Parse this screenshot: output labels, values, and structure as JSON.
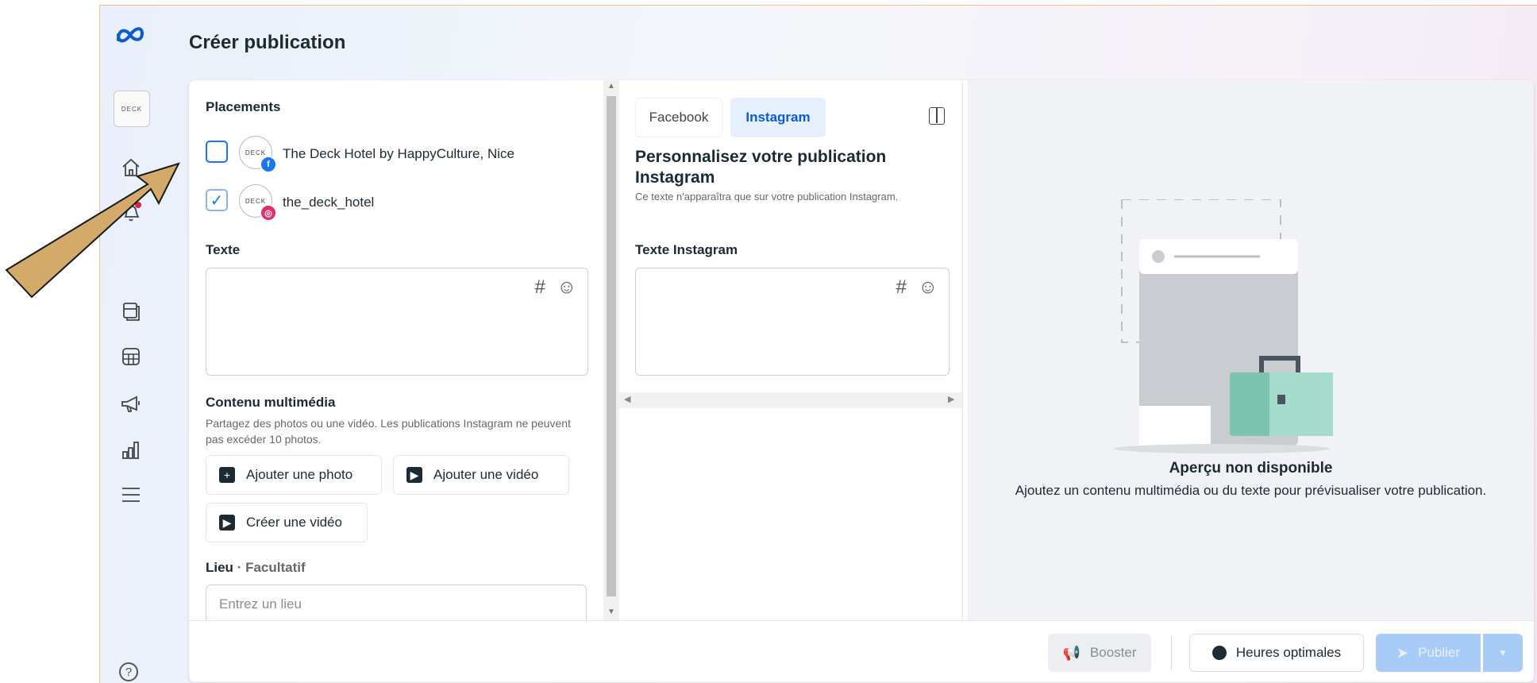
{
  "header": {
    "title": "Créer publication"
  },
  "sidebar": {
    "icons": [
      "meta-logo-icon",
      "page-avatar",
      "home-icon",
      "bell-icon",
      "chat-icon",
      "pages-icon",
      "table-icon",
      "megaphone-icon",
      "chart-icon",
      "menu-icon",
      "help-icon"
    ],
    "avatar_text": "DECK"
  },
  "placements": {
    "label": "Placements",
    "items": [
      {
        "name": "The Deck Hotel by HappyCulture, Nice",
        "checked": false,
        "network": "facebook"
      },
      {
        "name": "the_deck_hotel",
        "checked": true,
        "network": "instagram"
      }
    ],
    "avatar_text": "DECK"
  },
  "text_section": {
    "label": "Texte",
    "tools": [
      "#",
      "☺"
    ]
  },
  "media": {
    "label": "Contenu multimédia",
    "help": "Partagez des photos ou une vidéo. Les publications Instagram ne peuvent pas excéder 10 photos.",
    "buttons": [
      "Ajouter une photo",
      "Ajouter une vidéo",
      "Créer une vidéo"
    ]
  },
  "location": {
    "label": "Lieu",
    "optional": "· Facultatif",
    "placeholder": "Entrez un lieu"
  },
  "tabs": [
    {
      "label": "Facebook",
      "active": false
    },
    {
      "label": "Instagram",
      "active": true
    }
  ],
  "customize": {
    "title": "Personnalisez votre publication Instagram",
    "subtitle": "Ce texte n'apparaîtra que sur votre publication Instagram.",
    "field_label": "Texte Instagram",
    "tools": [
      "#",
      "☺"
    ]
  },
  "preview": {
    "title": "Aperçu non disponible",
    "subtitle": "Ajoutez un contenu multimédia ou du texte pour prévisualiser votre publication."
  },
  "footer": {
    "boost": "Booster",
    "best_times": "Heures optimales",
    "publish": "Publier"
  },
  "colors": {
    "accent": "#1877f2",
    "arrow_fill": "#d4aa6b",
    "arrow_stroke": "#1a1a1a",
    "preview_bg": "#f0f2f5"
  }
}
